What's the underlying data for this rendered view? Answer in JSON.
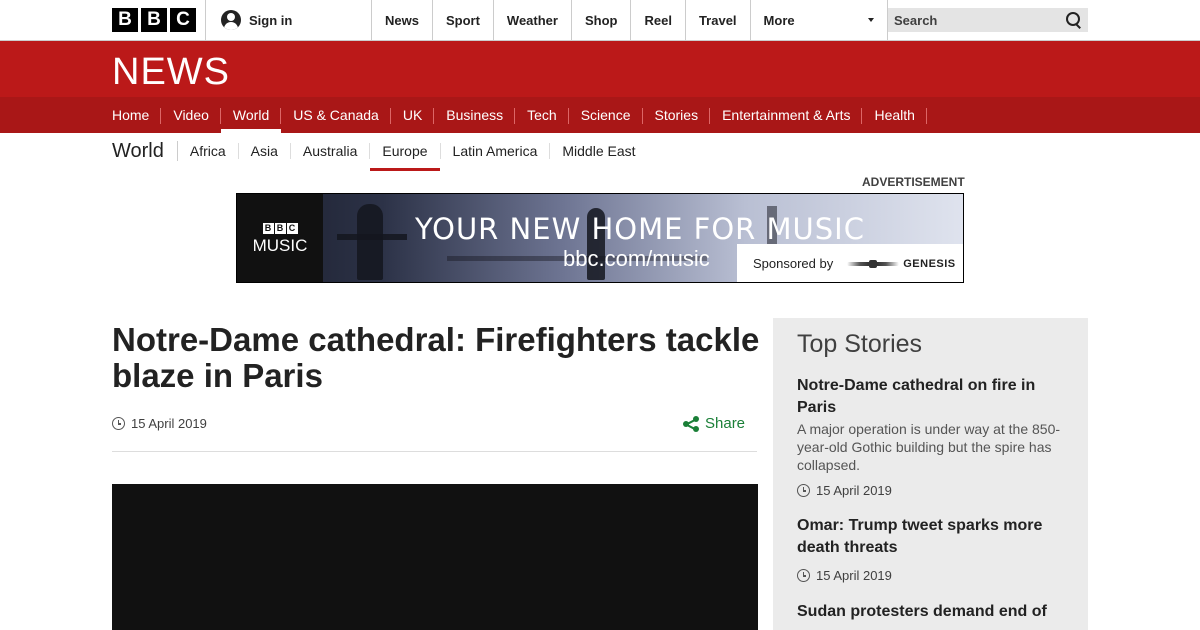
{
  "header": {
    "logo_letters": [
      "B",
      "B",
      "C"
    ],
    "signin_label": "Sign in",
    "nav": [
      "News",
      "Sport",
      "Weather",
      "Shop",
      "Reel",
      "Travel"
    ],
    "more_label": "More",
    "search_placeholder": "Search"
  },
  "masthead": {
    "title": "NEWS"
  },
  "section_nav": {
    "items": [
      "Home",
      "Video",
      "World",
      "US & Canada",
      "UK",
      "Business",
      "Tech",
      "Science",
      "Stories",
      "Entertainment & Arts",
      "Health"
    ],
    "active": "World"
  },
  "sub_nav": {
    "title": "World",
    "items": [
      "Africa",
      "Asia",
      "Australia",
      "Europe",
      "Latin America",
      "Middle East"
    ],
    "active": "Europe"
  },
  "advert": {
    "label": "ADVERTISEMENT",
    "brand_letters": [
      "B",
      "B",
      "C"
    ],
    "brand_sub": "MUSIC",
    "headline": "YOUR NEW HOME FOR MUSIC",
    "url": "bbc.com/music",
    "sponsored_by": "Sponsored by",
    "sponsor": "GENESIS"
  },
  "article": {
    "headline": "Notre-Dame cathedral: Firefighters tackle blaze in Paris",
    "date": "15 April 2019",
    "share_label": "Share"
  },
  "top_stories": {
    "title": "Top Stories",
    "stories": [
      {
        "title": "Notre-Dame cathedral on fire in Paris",
        "summary": "A major operation is under way at the 850-year-old Gothic building but the spire has collapsed.",
        "date": "15 April 2019"
      },
      {
        "title": "Omar: Trump tweet sparks more death threats",
        "summary": "",
        "date": "15 April 2019"
      },
      {
        "title": "Sudan protesters demand end of",
        "summary": "",
        "date": ""
      }
    ]
  },
  "colors": {
    "brand_red": "#bb1919",
    "nav_red": "#a91717",
    "share_green": "#1a7f37"
  }
}
